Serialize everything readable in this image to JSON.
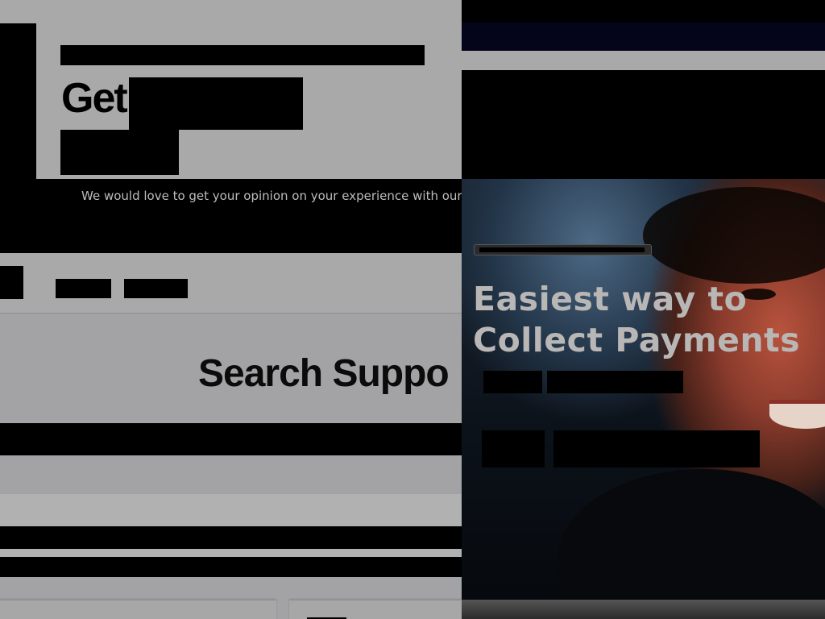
{
  "feedback": {
    "headline": "Get",
    "text": "We would love to get your opinion on your experience with our"
  },
  "search": {
    "title": "Search Suppo"
  },
  "hero": {
    "title_line1": "Easiest way to",
    "title_line2": "Collect Payments"
  }
}
